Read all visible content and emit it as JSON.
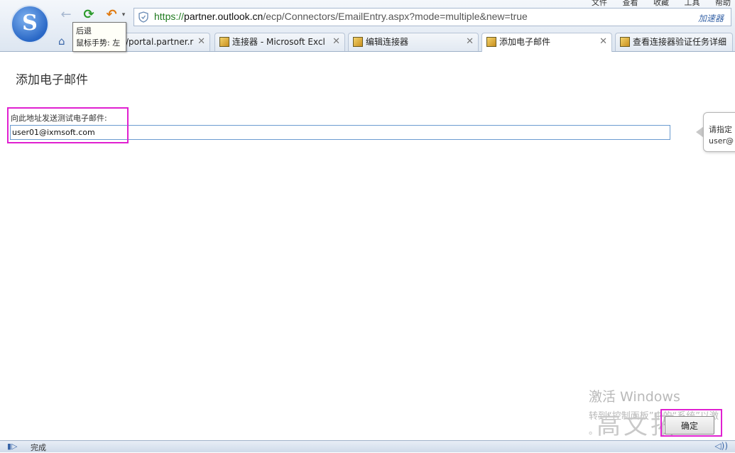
{
  "browser": {
    "menu": [
      "文件",
      "查看",
      "收藏",
      "工具",
      "帮助"
    ],
    "address": {
      "scheme": "https://",
      "host": "partner.outlook.cn",
      "path": "/ecp/Connectors/EmailEntry.aspx?mode=multiple&new=true",
      "accelerator": "加速器"
    },
    "tooltip": {
      "line1": "后退",
      "line2": "鼠标手势: 左"
    },
    "tabs": [
      {
        "label": "/portal.partner.r"
      },
      {
        "label": "连接器 - Microsoft Excl"
      },
      {
        "label": "编辑连接器"
      },
      {
        "label": "添加电子邮件"
      },
      {
        "label": "查看连接器验证任务详细"
      }
    ],
    "status": "完成"
  },
  "page": {
    "title": "添加电子邮件",
    "field_label": "向此地址发送测试电子邮件:",
    "email_value": "user01@ixmsoft.com",
    "callout": {
      "line1": "请指定",
      "line2": "user@"
    },
    "ok_label": "确定"
  },
  "watermark": {
    "line1": "激活 Windows",
    "line2": "转到“控制面板”中的“系统”以激",
    "line3": "。",
    "brand": "高文拓"
  }
}
